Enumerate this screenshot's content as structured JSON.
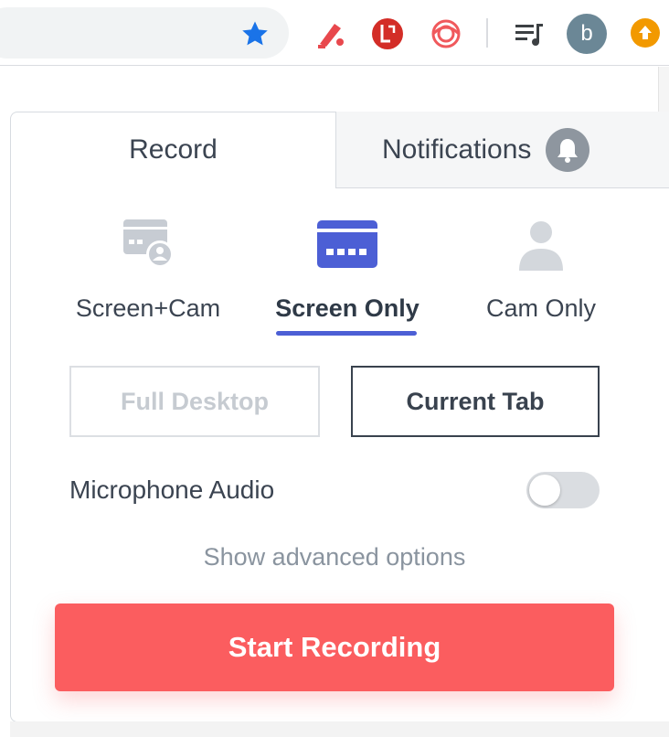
{
  "browser": {
    "avatar_letter": "b",
    "icons": [
      "bookmark-star-icon",
      "highlighter-extension-icon",
      "lastpass-extension-icon",
      "swirl-extension-icon",
      "playlist-icon",
      "update-icon"
    ]
  },
  "tabs": {
    "record_label": "Record",
    "notifications_label": "Notifications"
  },
  "modes": {
    "screen_cam": "Screen+Cam",
    "screen_only": "Screen Only",
    "cam_only": "Cam Only",
    "selected": "Screen Only"
  },
  "scope": {
    "full_desktop": "Full Desktop",
    "current_tab": "Current Tab",
    "selected": "Current Tab"
  },
  "microphone": {
    "label": "Microphone Audio",
    "enabled": false
  },
  "advanced_link": "Show advanced options",
  "start_button": "Start Recording",
  "colors": {
    "accent": "#4c5fd5",
    "record": "#fb5d5f"
  }
}
